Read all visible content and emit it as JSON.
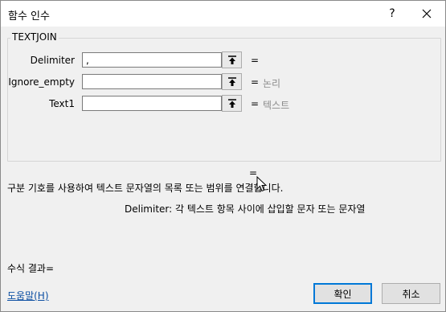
{
  "window": {
    "title": "함수 인수",
    "help_label": "?"
  },
  "group": {
    "function_name": "TEXTJOIN"
  },
  "arguments": [
    {
      "label": "Delimiter",
      "value": ",",
      "equals": "=",
      "result": ""
    },
    {
      "label": "Ignore_empty",
      "value": "",
      "equals": "=",
      "result": "논리"
    },
    {
      "label": "Text1",
      "value": "",
      "equals": "=",
      "result": "텍스트"
    }
  ],
  "result_equals": "=",
  "description": "구분 기호를 사용하여 텍스트 문자열의 목록 또는 범위를 연결합니다.",
  "argument_description": "Delimiter:  각 텍스트 항목 사이에 삽입할 문자 또는 문자열",
  "formula_result": "수식 결과=",
  "help_link": "도움말(H)",
  "buttons": {
    "ok": "확인",
    "cancel": "취소"
  },
  "icons": {
    "close": "close-icon",
    "collapse": "collapse-dialog-icon",
    "cursor": "mouse-pointer-icon"
  }
}
